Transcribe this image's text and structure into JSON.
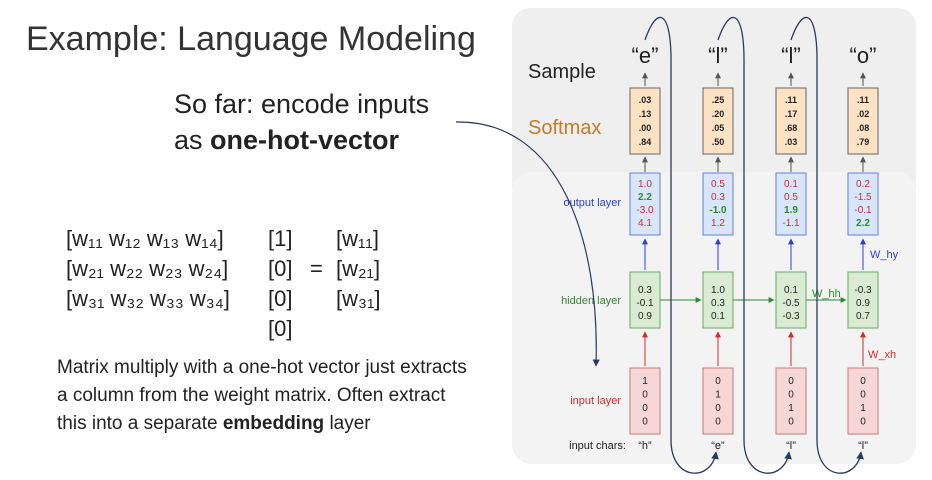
{
  "title": "Example: Language Modeling",
  "intro": {
    "line1": "So far: encode inputs",
    "line2_prefix": "as ",
    "line2_bold": "one-hot-vector"
  },
  "matrix_equation": {
    "rows": [
      {
        "weights": "[w₁₁ w₁₂ w₁₃ w₁₄]",
        "onehot": "[1]",
        "equals": "",
        "result": "[w₁₁]"
      },
      {
        "weights": "[w₂₁ w₂₂ w₂₃ w₂₄]",
        "onehot": "[0]",
        "equals": "=",
        "result": "[w₂₁]"
      },
      {
        "weights": "[w₃₁ w₃₂ w₃₃ w₃₄]",
        "onehot": "[0]",
        "equals": "",
        "result": "[w₃₁]"
      },
      {
        "weights": "",
        "onehot": "[0]",
        "equals": "",
        "result": ""
      }
    ]
  },
  "explanation": {
    "text": "Matrix multiply with a one-hot vector just extracts a column from the weight matrix. Often extract this into a separate ",
    "bold": "embedding",
    "tail": " layer"
  },
  "diagram": {
    "sample_label": "Sample",
    "softmax_label": "Softmax",
    "output_layer_label": "output layer",
    "hidden_layer_label": "hidden layer",
    "input_layer_label": "input layer",
    "input_chars_label": "input chars:",
    "w_hy": "W_hy",
    "w_hh": "W_hh",
    "w_xh": "W_xh",
    "colors": {
      "softmax": "#c77a2c",
      "output": "#2b3fd6",
      "hidden": "#2f8a2f",
      "input": "#d12b2b"
    },
    "steps": [
      {
        "sample": "“e”",
        "softmax": [
          ".03",
          ".13",
          ".00",
          ".84"
        ],
        "output": [
          "1.0",
          "2.2",
          "-3.0",
          "4.1"
        ],
        "output_colors": [
          "#d12b2b",
          "#2f8a2f",
          "#d12b2b",
          "#d12b2b"
        ],
        "output_bold": [
          false,
          true,
          false,
          false
        ],
        "hidden": [
          "0.3",
          "-0.1",
          "0.9"
        ],
        "input": [
          "1",
          "0",
          "0",
          "0"
        ],
        "char": "“h”"
      },
      {
        "sample": "“l”",
        "softmax": [
          ".25",
          ".20",
          ".05",
          ".50"
        ],
        "output": [
          "0.5",
          "0.3",
          "-1.0",
          "1.2"
        ],
        "output_colors": [
          "#d12b2b",
          "#d12b2b",
          "#2f8a2f",
          "#d12b2b"
        ],
        "output_bold": [
          false,
          false,
          true,
          false
        ],
        "hidden": [
          "1.0",
          "0.3",
          "0.1"
        ],
        "input": [
          "0",
          "1",
          "0",
          "0"
        ],
        "char": "“e”"
      },
      {
        "sample": "“l”",
        "softmax": [
          ".11",
          ".17",
          ".68",
          ".03"
        ],
        "output": [
          "0.1",
          "0.5",
          "1.9",
          "-1.1"
        ],
        "output_colors": [
          "#d12b2b",
          "#d12b2b",
          "#2f8a2f",
          "#d12b2b"
        ],
        "output_bold": [
          false,
          false,
          true,
          false
        ],
        "hidden": [
          "0.1",
          "-0.5",
          "-0.3"
        ],
        "input": [
          "0",
          "0",
          "1",
          "0"
        ],
        "char": "“l”"
      },
      {
        "sample": "“o”",
        "softmax": [
          ".11",
          ".02",
          ".08",
          ".79"
        ],
        "output": [
          "0.2",
          "-1.5",
          "-0.1",
          "2.2"
        ],
        "output_colors": [
          "#d12b2b",
          "#d12b2b",
          "#d12b2b",
          "#2f8a2f"
        ],
        "output_bold": [
          false,
          false,
          false,
          true
        ],
        "hidden": [
          "-0.3",
          "0.9",
          "0.7"
        ],
        "input": [
          "0",
          "0",
          "1",
          "0"
        ],
        "char": "“l”"
      }
    ]
  }
}
